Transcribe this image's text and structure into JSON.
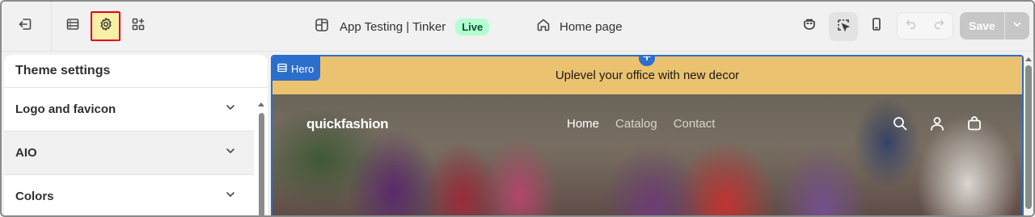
{
  "topbar": {
    "store_name": "App Testing | Tinker",
    "live_badge": "Live",
    "page_name": "Home page",
    "save_label": "Save",
    "icons": [
      "exit-icon",
      "sections-icon",
      "gear-icon",
      "apps-icon",
      "store-icon",
      "home-icon",
      "mask-icon",
      "inspector-icon",
      "mobile-icon",
      "undo-icon",
      "redo-icon",
      "chevron-down-icon"
    ]
  },
  "sidebar": {
    "title": "Theme settings",
    "items": [
      {
        "label": "Logo and favicon"
      },
      {
        "label": "AIO"
      },
      {
        "label": "Colors"
      }
    ]
  },
  "preview": {
    "section_tag": "Hero",
    "announcement": "Uplevel your office with new decor",
    "logo": "quickfashion",
    "nav": [
      "Home",
      "Catalog",
      "Contact"
    ],
    "current_nav": "Home"
  },
  "colors": {
    "accent": "#2c6ecb",
    "live_badge_bg": "#b4fed2",
    "highlight_border": "#e0001b",
    "highlight_fill": "#f8f0a4",
    "announcement_bg": "#ebc26f"
  }
}
